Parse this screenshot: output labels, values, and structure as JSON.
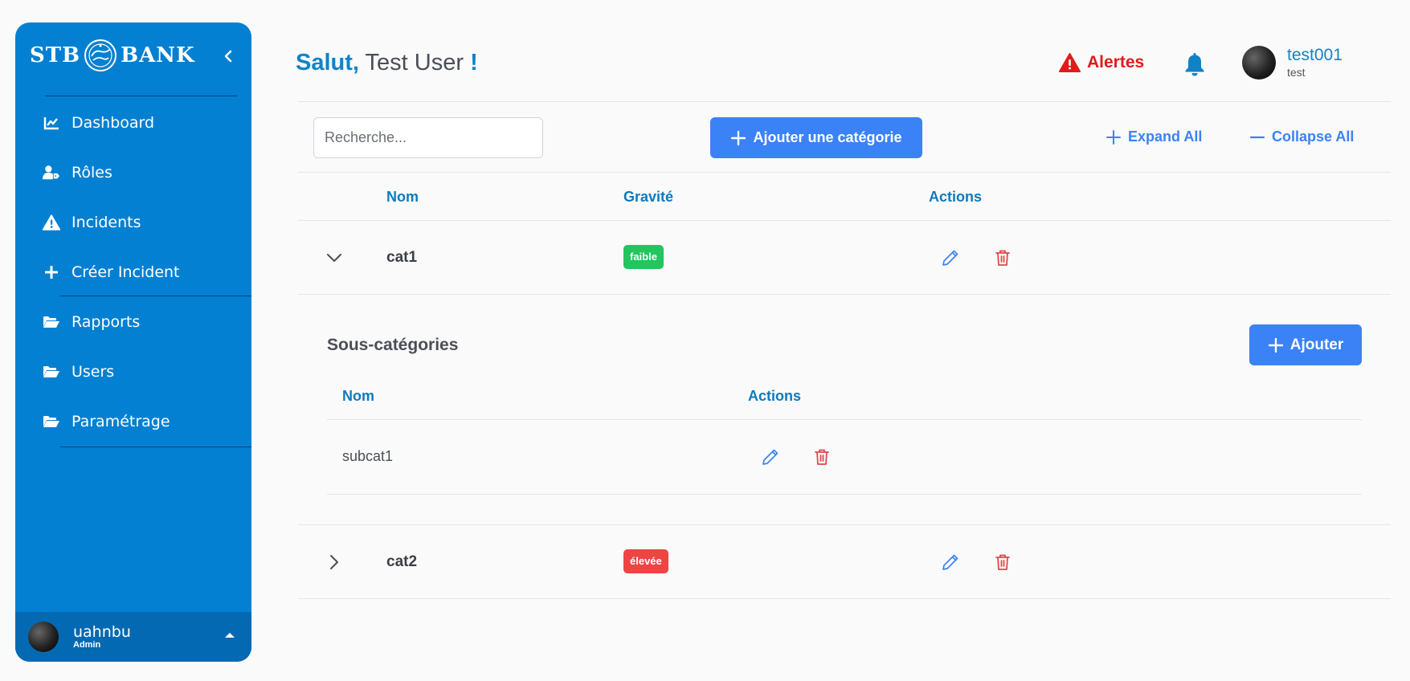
{
  "sidebar": {
    "logo_left": "STB",
    "logo_right": "BANK",
    "items": [
      {
        "label": "Dashboard",
        "icon": "chart-line-icon"
      },
      {
        "label": "Rôles",
        "icon": "user-tag-icon"
      },
      {
        "label": "Incidents",
        "icon": "warning-icon"
      },
      {
        "label": "Créer Incident",
        "icon": "plus-icon"
      },
      {
        "label": "Rapports",
        "icon": "folder-icon"
      },
      {
        "label": "Users",
        "icon": "folder-icon"
      },
      {
        "label": "Paramétrage",
        "icon": "folder-icon"
      }
    ],
    "user": {
      "name": "uahnbu",
      "role": "Admin"
    }
  },
  "header": {
    "greeting": "Salut,",
    "user_name": "Test User",
    "exclaim": "!",
    "alerts_label": "Alertes",
    "user": {
      "name": "test001",
      "role": "test"
    }
  },
  "toolbar": {
    "search_placeholder": "Recherche...",
    "add_category_label": "Ajouter une catégorie",
    "expand_all_label": "Expand All",
    "collapse_all_label": "Collapse All"
  },
  "table": {
    "columns": [
      "Nom",
      "Gravité",
      "Actions"
    ],
    "categories": [
      {
        "name": "cat1",
        "severity": "faible",
        "severity_color": "#22c55e",
        "expanded": true
      },
      {
        "name": "cat2",
        "severity": "élevée",
        "severity_color": "#ef4444",
        "expanded": false
      }
    ]
  },
  "subcategories": {
    "title": "Sous-catégories",
    "add_label": "Ajouter",
    "columns": [
      "Nom",
      "Actions"
    ],
    "rows": [
      {
        "name": "subcat1"
      }
    ]
  },
  "colors": {
    "sidebar": "#0380d2",
    "primary": "#3b82f6",
    "accent_text": "#1083c7",
    "alert": "#e01b1b",
    "edit_icon": "#3b82f6",
    "delete_icon": "#e0484a"
  }
}
